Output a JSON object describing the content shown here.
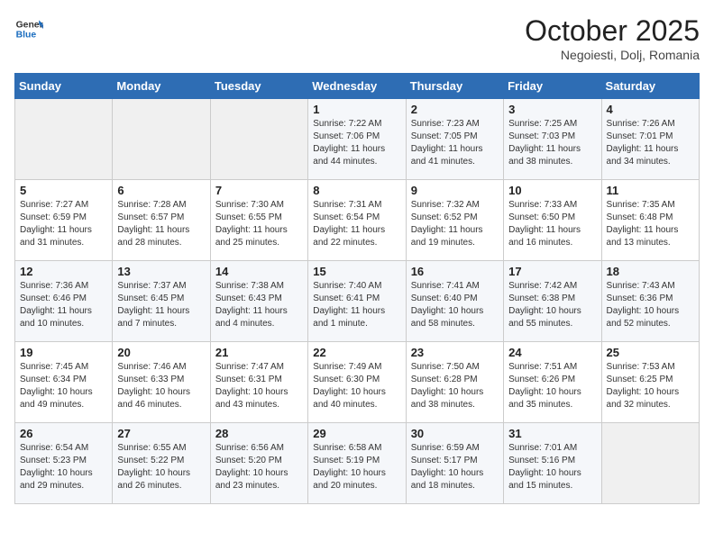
{
  "header": {
    "logo_general": "General",
    "logo_blue": "Blue",
    "month_title": "October 2025",
    "subtitle": "Negoiesti, Dolj, Romania"
  },
  "weekdays": [
    "Sunday",
    "Monday",
    "Tuesday",
    "Wednesday",
    "Thursday",
    "Friday",
    "Saturday"
  ],
  "weeks": [
    [
      {
        "day": "",
        "info": ""
      },
      {
        "day": "",
        "info": ""
      },
      {
        "day": "",
        "info": ""
      },
      {
        "day": "1",
        "info": "Sunrise: 7:22 AM\nSunset: 7:06 PM\nDaylight: 11 hours\nand 44 minutes."
      },
      {
        "day": "2",
        "info": "Sunrise: 7:23 AM\nSunset: 7:05 PM\nDaylight: 11 hours\nand 41 minutes."
      },
      {
        "day": "3",
        "info": "Sunrise: 7:25 AM\nSunset: 7:03 PM\nDaylight: 11 hours\nand 38 minutes."
      },
      {
        "day": "4",
        "info": "Sunrise: 7:26 AM\nSunset: 7:01 PM\nDaylight: 11 hours\nand 34 minutes."
      }
    ],
    [
      {
        "day": "5",
        "info": "Sunrise: 7:27 AM\nSunset: 6:59 PM\nDaylight: 11 hours\nand 31 minutes."
      },
      {
        "day": "6",
        "info": "Sunrise: 7:28 AM\nSunset: 6:57 PM\nDaylight: 11 hours\nand 28 minutes."
      },
      {
        "day": "7",
        "info": "Sunrise: 7:30 AM\nSunset: 6:55 PM\nDaylight: 11 hours\nand 25 minutes."
      },
      {
        "day": "8",
        "info": "Sunrise: 7:31 AM\nSunset: 6:54 PM\nDaylight: 11 hours\nand 22 minutes."
      },
      {
        "day": "9",
        "info": "Sunrise: 7:32 AM\nSunset: 6:52 PM\nDaylight: 11 hours\nand 19 minutes."
      },
      {
        "day": "10",
        "info": "Sunrise: 7:33 AM\nSunset: 6:50 PM\nDaylight: 11 hours\nand 16 minutes."
      },
      {
        "day": "11",
        "info": "Sunrise: 7:35 AM\nSunset: 6:48 PM\nDaylight: 11 hours\nand 13 minutes."
      }
    ],
    [
      {
        "day": "12",
        "info": "Sunrise: 7:36 AM\nSunset: 6:46 PM\nDaylight: 11 hours\nand 10 minutes."
      },
      {
        "day": "13",
        "info": "Sunrise: 7:37 AM\nSunset: 6:45 PM\nDaylight: 11 hours\nand 7 minutes."
      },
      {
        "day": "14",
        "info": "Sunrise: 7:38 AM\nSunset: 6:43 PM\nDaylight: 11 hours\nand 4 minutes."
      },
      {
        "day": "15",
        "info": "Sunrise: 7:40 AM\nSunset: 6:41 PM\nDaylight: 11 hours\nand 1 minute."
      },
      {
        "day": "16",
        "info": "Sunrise: 7:41 AM\nSunset: 6:40 PM\nDaylight: 10 hours\nand 58 minutes."
      },
      {
        "day": "17",
        "info": "Sunrise: 7:42 AM\nSunset: 6:38 PM\nDaylight: 10 hours\nand 55 minutes."
      },
      {
        "day": "18",
        "info": "Sunrise: 7:43 AM\nSunset: 6:36 PM\nDaylight: 10 hours\nand 52 minutes."
      }
    ],
    [
      {
        "day": "19",
        "info": "Sunrise: 7:45 AM\nSunset: 6:34 PM\nDaylight: 10 hours\nand 49 minutes."
      },
      {
        "day": "20",
        "info": "Sunrise: 7:46 AM\nSunset: 6:33 PM\nDaylight: 10 hours\nand 46 minutes."
      },
      {
        "day": "21",
        "info": "Sunrise: 7:47 AM\nSunset: 6:31 PM\nDaylight: 10 hours\nand 43 minutes."
      },
      {
        "day": "22",
        "info": "Sunrise: 7:49 AM\nSunset: 6:30 PM\nDaylight: 10 hours\nand 40 minutes."
      },
      {
        "day": "23",
        "info": "Sunrise: 7:50 AM\nSunset: 6:28 PM\nDaylight: 10 hours\nand 38 minutes."
      },
      {
        "day": "24",
        "info": "Sunrise: 7:51 AM\nSunset: 6:26 PM\nDaylight: 10 hours\nand 35 minutes."
      },
      {
        "day": "25",
        "info": "Sunrise: 7:53 AM\nSunset: 6:25 PM\nDaylight: 10 hours\nand 32 minutes."
      }
    ],
    [
      {
        "day": "26",
        "info": "Sunrise: 6:54 AM\nSunset: 5:23 PM\nDaylight: 10 hours\nand 29 minutes."
      },
      {
        "day": "27",
        "info": "Sunrise: 6:55 AM\nSunset: 5:22 PM\nDaylight: 10 hours\nand 26 minutes."
      },
      {
        "day": "28",
        "info": "Sunrise: 6:56 AM\nSunset: 5:20 PM\nDaylight: 10 hours\nand 23 minutes."
      },
      {
        "day": "29",
        "info": "Sunrise: 6:58 AM\nSunset: 5:19 PM\nDaylight: 10 hours\nand 20 minutes."
      },
      {
        "day": "30",
        "info": "Sunrise: 6:59 AM\nSunset: 5:17 PM\nDaylight: 10 hours\nand 18 minutes."
      },
      {
        "day": "31",
        "info": "Sunrise: 7:01 AM\nSunset: 5:16 PM\nDaylight: 10 hours\nand 15 minutes."
      },
      {
        "day": "",
        "info": ""
      }
    ]
  ]
}
